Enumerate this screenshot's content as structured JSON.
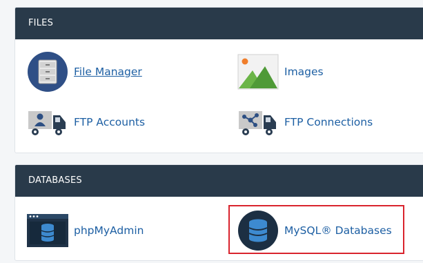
{
  "files": {
    "header": "FILES",
    "items": [
      {
        "label": "File Manager",
        "icon": "file-cabinet-icon"
      },
      {
        "label": "Images",
        "icon": "image-icon"
      },
      {
        "label": "FTP Accounts",
        "icon": "ftp-user-truck-icon"
      },
      {
        "label": "FTP Connections",
        "icon": "ftp-network-truck-icon"
      }
    ]
  },
  "databases": {
    "header": "DATABASES",
    "items": [
      {
        "label": "phpMyAdmin",
        "icon": "phpmyadmin-icon"
      },
      {
        "label": "MySQL® Databases",
        "icon": "database-icon"
      }
    ]
  },
  "colors": {
    "header_bg": "#293a4a",
    "link": "#1d5fa3",
    "highlight": "#d9232d"
  }
}
